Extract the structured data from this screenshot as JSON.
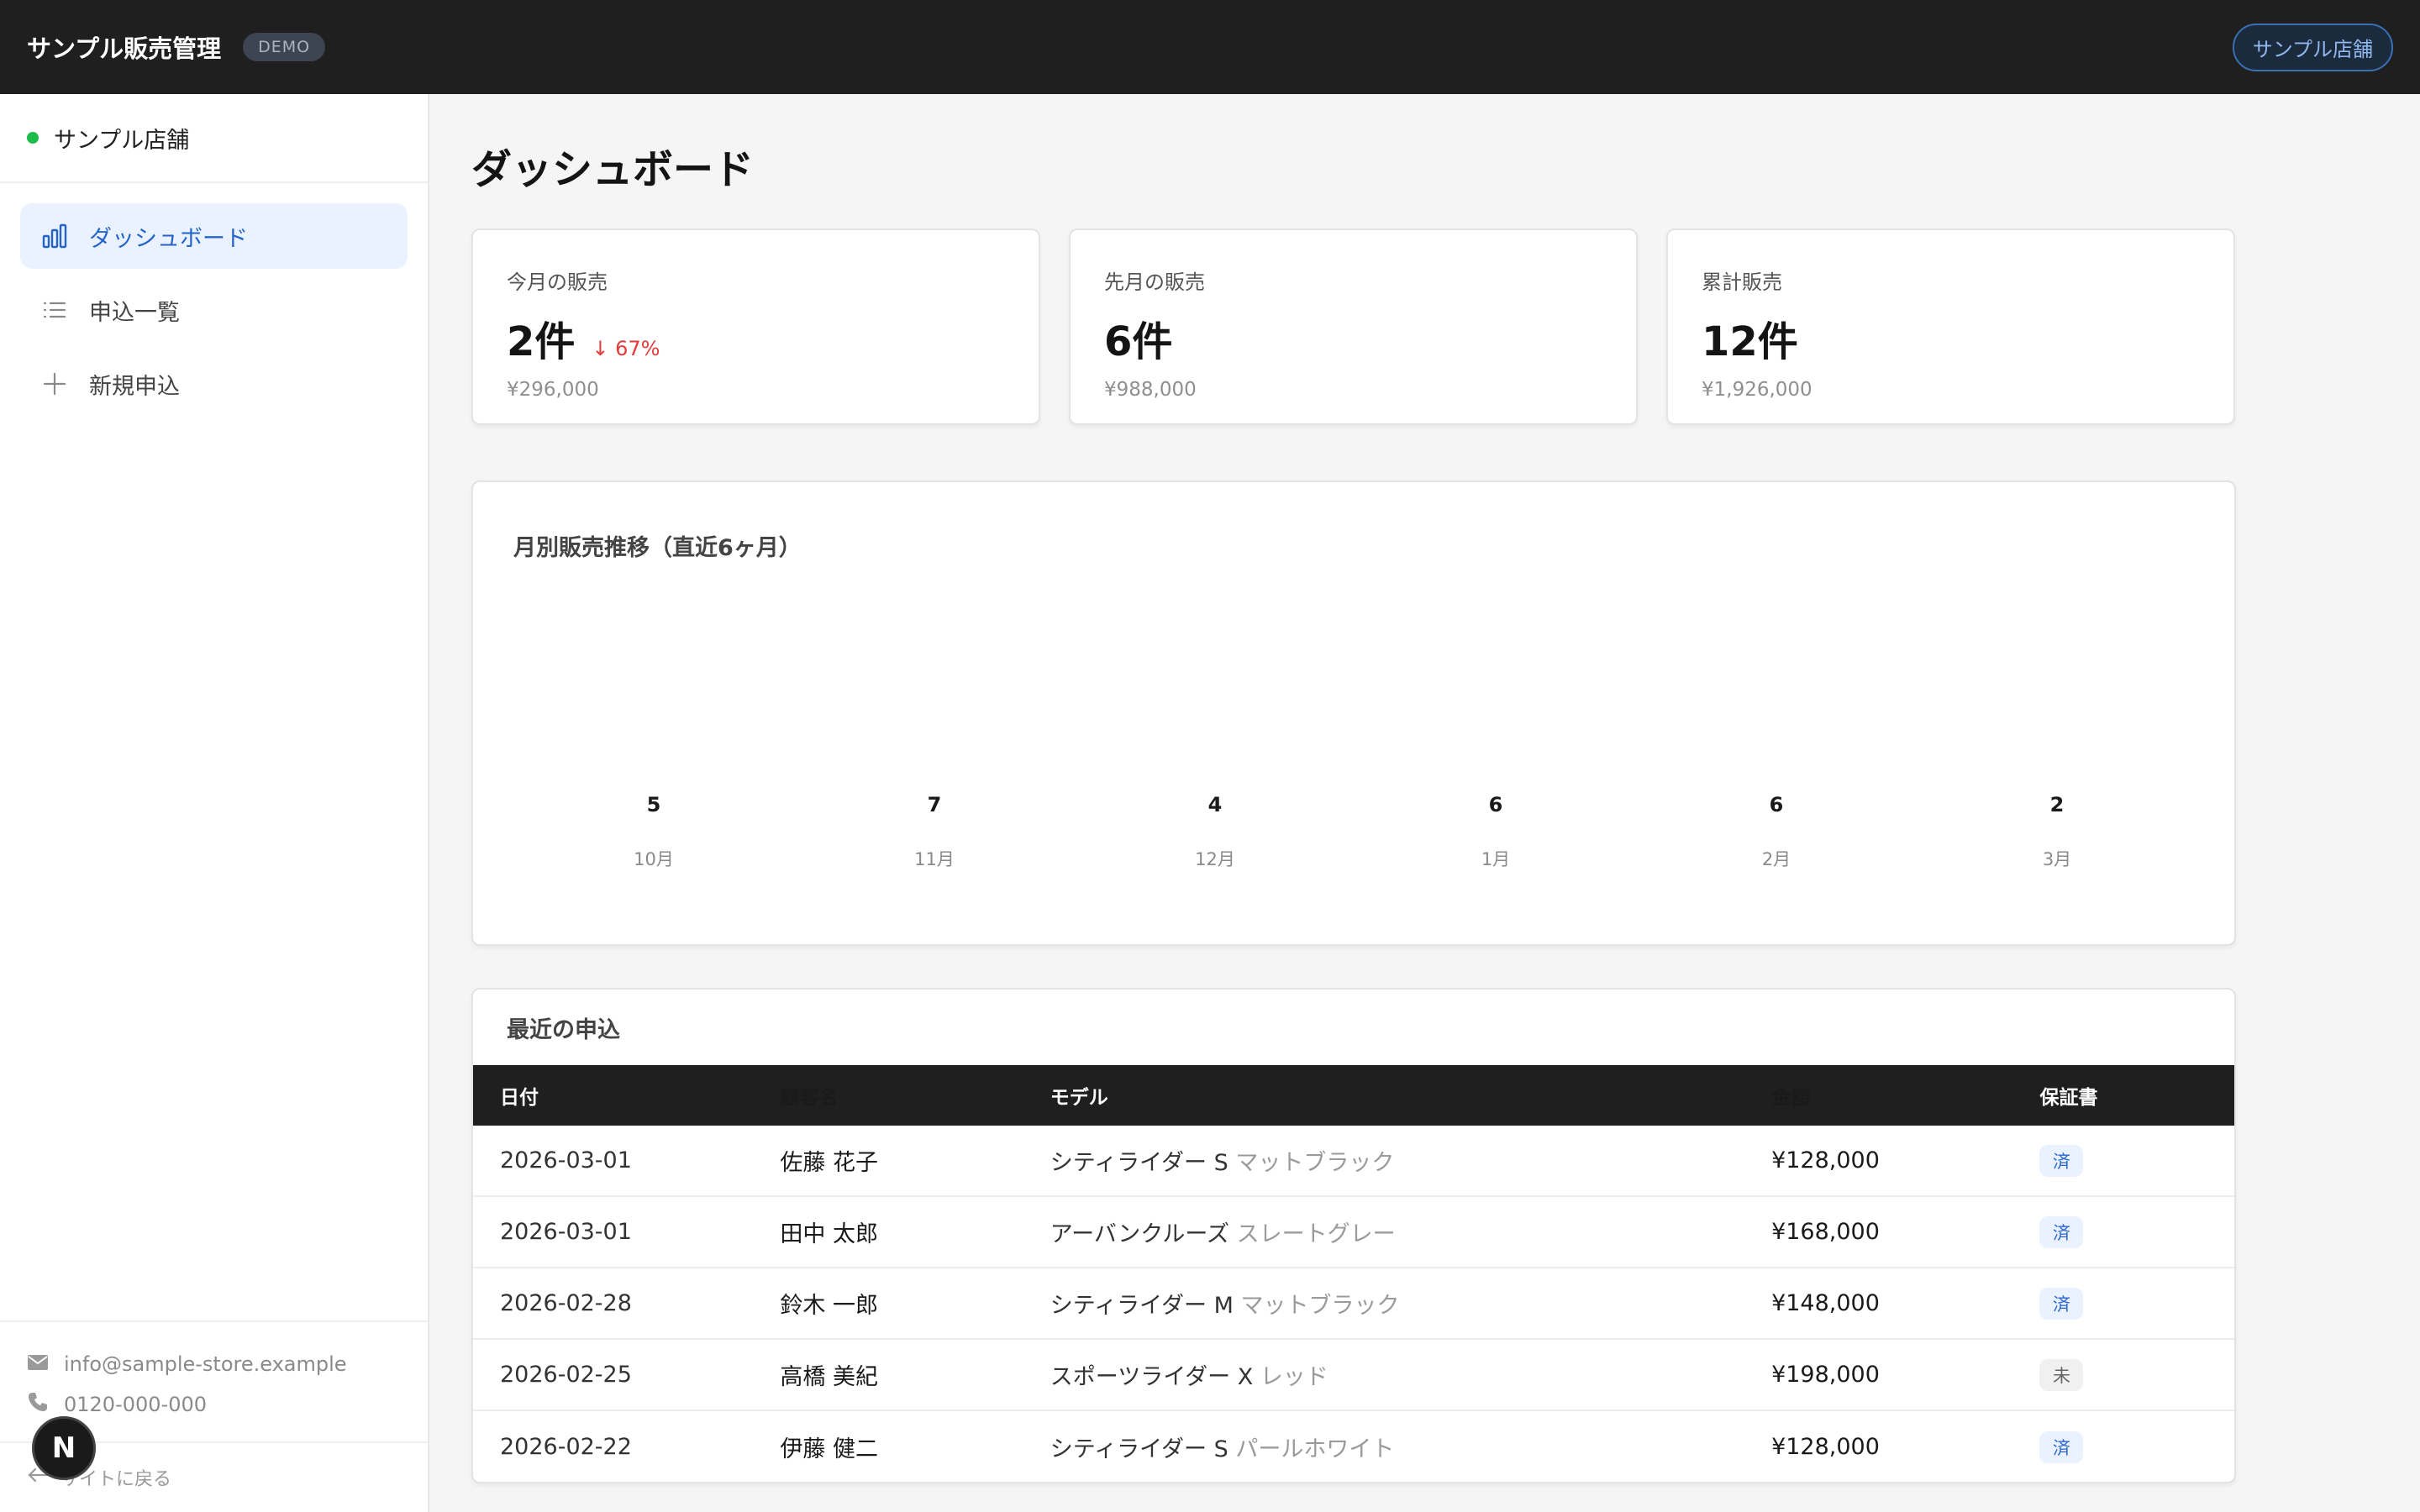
{
  "header": {
    "title": "サンプル販売管理",
    "badge": "DEMO",
    "store_button": "サンプル店舗"
  },
  "sidebar": {
    "store_name": "サンプル店舗",
    "items": [
      {
        "label": "ダッシュボード",
        "icon": "bar-chart-icon",
        "active": true
      },
      {
        "label": "申込一覧",
        "icon": "list-icon",
        "active": false
      },
      {
        "label": "新規申込",
        "icon": "plus-icon",
        "active": false
      }
    ],
    "email": "info@sample-store.example",
    "phone": "0120-000-000",
    "back_label": "サイトに戻る",
    "n_badge": "N"
  },
  "page": {
    "title": "ダッシュボード"
  },
  "stats": [
    {
      "label": "今月の販売",
      "value": "2件",
      "delta": "↓ 67%",
      "amount": "¥296,000"
    },
    {
      "label": "先月の販売",
      "value": "6件",
      "delta": "",
      "amount": "¥988,000"
    },
    {
      "label": "累計販売",
      "value": "12件",
      "delta": "",
      "amount": "¥1,926,000"
    }
  ],
  "chart": {
    "title": "月別販売推移（直近6ヶ月）"
  },
  "chart_data": {
    "type": "bar",
    "categories": [
      "10月",
      "11月",
      "12月",
      "1月",
      "2月",
      "3月"
    ],
    "values": [
      5,
      7,
      4,
      6,
      6,
      2
    ],
    "title": "月別販売推移（直近6ヶ月）",
    "xlabel": "",
    "ylabel": "",
    "grid": false,
    "data_labels": true
  },
  "recent": {
    "title": "最近の申込",
    "columns": [
      "日付",
      "顧客名",
      "モデル",
      "金額",
      "保証書"
    ],
    "rows": [
      {
        "date": "2026-03-01",
        "name": "佐藤 花子",
        "model": "シティライダー S",
        "variant": "マットブラック",
        "amount": "¥128,000",
        "warranty": "済"
      },
      {
        "date": "2026-03-01",
        "name": "田中 太郎",
        "model": "アーバンクルーズ",
        "variant": "スレートグレー",
        "amount": "¥168,000",
        "warranty": "済"
      },
      {
        "date": "2026-02-28",
        "name": "鈴木 一郎",
        "model": "シティライダー M",
        "variant": "マットブラック",
        "amount": "¥148,000",
        "warranty": "済"
      },
      {
        "date": "2026-02-25",
        "name": "高橋 美紀",
        "model": "スポーツライダー X",
        "variant": "レッド",
        "amount": "¥198,000",
        "warranty": "未"
      },
      {
        "date": "2026-02-22",
        "name": "伊藤 健二",
        "model": "シティライダー S",
        "variant": "パールホワイト",
        "amount": "¥128,000",
        "warranty": "済"
      }
    ]
  },
  "colors": {
    "accent": "#2563c9",
    "header_bg": "#1f1f1f",
    "negative": "#e23b3b",
    "online": "#1bbd4c"
  }
}
